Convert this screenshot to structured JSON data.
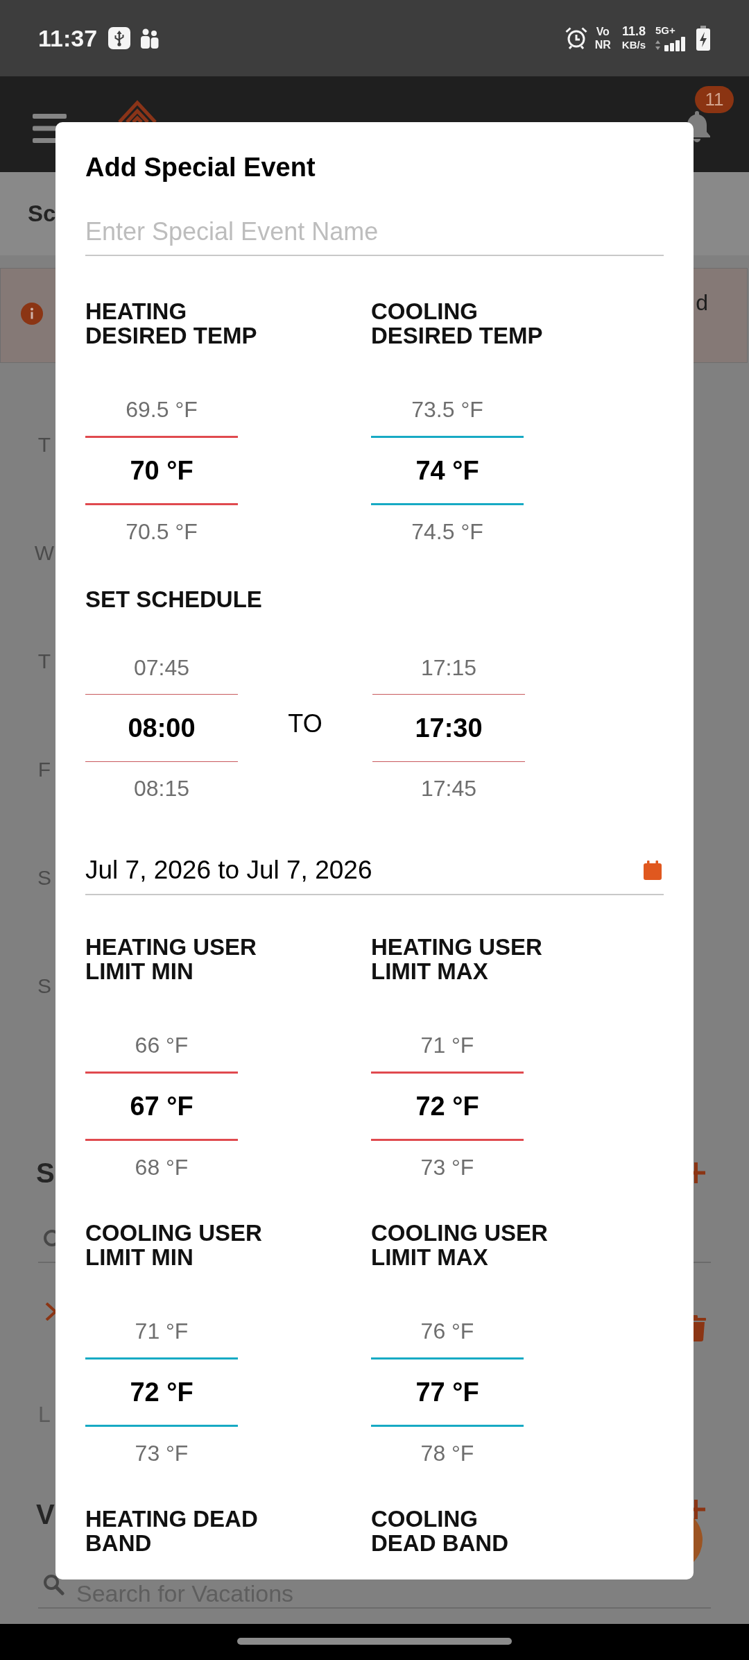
{
  "status_bar": {
    "time": "11:37",
    "voice_top": "Vo",
    "voice_bottom": "NR",
    "speed_value": "11.8",
    "speed_unit": "KB/s",
    "network": "5G+"
  },
  "app_bar": {
    "notification_count": "11"
  },
  "background": {
    "heading": "Sc",
    "alert_text": "d",
    "day_labels": [
      "T",
      "W",
      "T",
      "F",
      "S",
      "S"
    ],
    "special_events_heading": "S",
    "list_row_text": "L",
    "vacations_heading": "V",
    "vacation_search": {
      "placeholder": "Search for Vacations"
    }
  },
  "dialog": {
    "title": "Add Special Event",
    "name_field": {
      "placeholder": "Enter Special Event Name"
    },
    "sections": [
      {
        "kind": "pair",
        "items": [
          {
            "label": "HEATING\nDESIRED TEMP",
            "picker": {
              "kind": "temp",
              "color": "#e04a4f",
              "options": [
                {
                  "text": "69.5 °F",
                  "selected": false
                },
                {
                  "text": "70 °F",
                  "selected": true
                },
                {
                  "text": "70.5 °F",
                  "selected": false
                }
              ]
            }
          },
          {
            "label": "COOLING\nDESIRED TEMP",
            "picker": {
              "kind": "temp",
              "color": "#17aac4",
              "options": [
                {
                  "text": "73.5 °F",
                  "selected": false
                },
                {
                  "text": "74 °F",
                  "selected": true
                },
                {
                  "text": "74.5 °F",
                  "selected": false
                }
              ]
            }
          }
        ]
      },
      {
        "kind": "schedule",
        "label": "SET SCHEDULE",
        "separator": "TO",
        "pickers": [
          {
            "kind": "time",
            "color": "#c8595d",
            "options": [
              {
                "text": "07:45",
                "selected": false
              },
              {
                "text": "08:00",
                "selected": true
              },
              {
                "text": "08:15",
                "selected": false
              }
            ]
          },
          {
            "kind": "time",
            "color": "#c8595d",
            "options": [
              {
                "text": "17:15",
                "selected": false
              },
              {
                "text": "17:30",
                "selected": true
              },
              {
                "text": "17:45",
                "selected": false
              }
            ]
          }
        ]
      },
      {
        "kind": "date_range",
        "value": "Jul 7, 2026 to Jul 7, 2026"
      },
      {
        "kind": "pair",
        "items": [
          {
            "label": "HEATING USER\nLIMIT MIN",
            "picker": {
              "kind": "temp",
              "color": "#e04a4f",
              "options": [
                {
                  "text": "66 °F",
                  "selected": false
                },
                {
                  "text": "67 °F",
                  "selected": true
                },
                {
                  "text": "68 °F",
                  "selected": false
                }
              ]
            }
          },
          {
            "label": "HEATING USER\nLIMIT MAX",
            "picker": {
              "kind": "temp",
              "color": "#e04a4f",
              "options": [
                {
                  "text": "71 °F",
                  "selected": false
                },
                {
                  "text": "72 °F",
                  "selected": true
                },
                {
                  "text": "73 °F",
                  "selected": false
                }
              ]
            }
          }
        ]
      },
      {
        "kind": "pair",
        "items": [
          {
            "label": "COOLING USER\nLIMIT MIN",
            "picker": {
              "kind": "temp",
              "color": "#17aac4",
              "options": [
                {
                  "text": "71 °F",
                  "selected": false
                },
                {
                  "text": "72 °F",
                  "selected": true
                },
                {
                  "text": "73 °F",
                  "selected": false
                }
              ]
            }
          },
          {
            "label": "COOLING USER\nLIMIT MAX",
            "picker": {
              "kind": "temp",
              "color": "#17aac4",
              "options": [
                {
                  "text": "76 °F",
                  "selected": false
                },
                {
                  "text": "77 °F",
                  "selected": true
                },
                {
                  "text": "78 °F",
                  "selected": false
                }
              ]
            }
          }
        ]
      },
      {
        "kind": "pair",
        "items": [
          {
            "label": "HEATING DEAD\nBAND"
          },
          {
            "label": "COOLING\nDEAD BAND"
          }
        ]
      }
    ]
  }
}
